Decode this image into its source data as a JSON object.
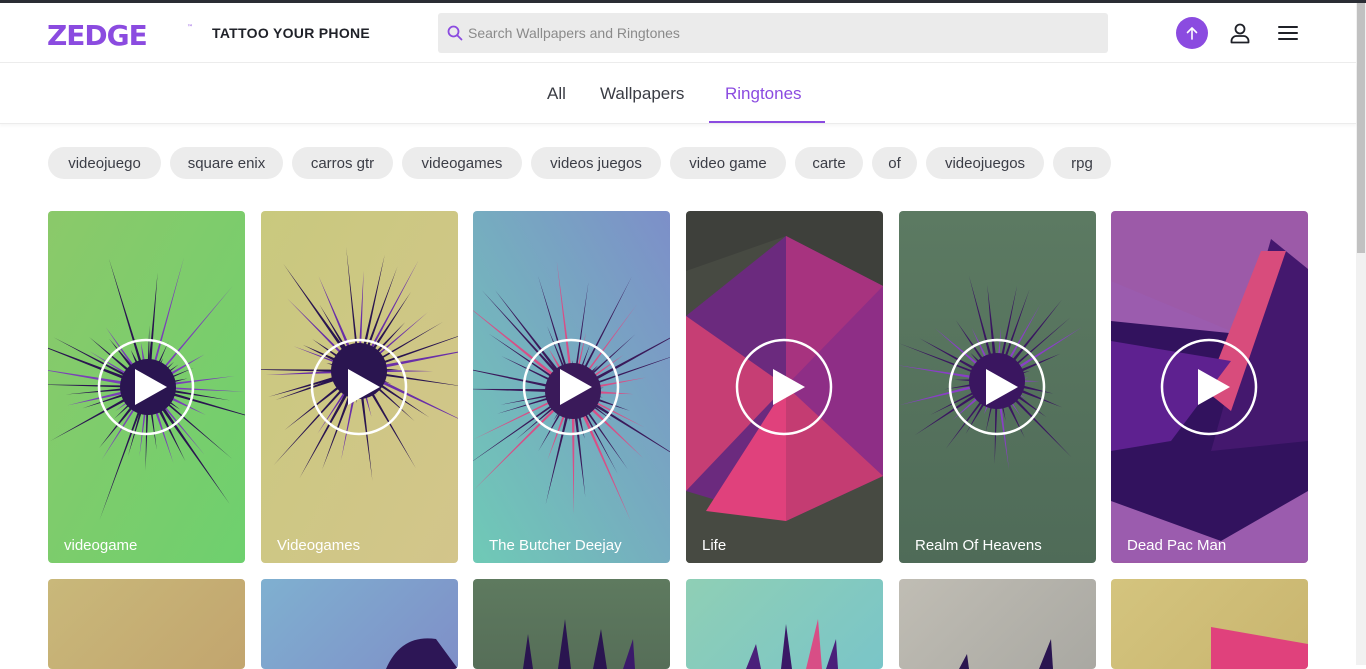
{
  "header": {
    "logo_text": "ZEDGE",
    "tagline": "TATTOO YOUR PHONE",
    "search_placeholder": "Search Wallpapers and Ringtones",
    "brand_color": "#8b4be0",
    "icons": [
      "search-icon",
      "upload-arrow-icon",
      "user-icon",
      "hamburger-menu-icon"
    ]
  },
  "tabs": [
    {
      "label": "All",
      "active": false
    },
    {
      "label": "Wallpapers",
      "active": false
    },
    {
      "label": "Ringtones",
      "active": true
    }
  ],
  "chips": [
    "videojuego",
    "square enix",
    "carros gtr",
    "videogames",
    "videos juegos",
    "video game",
    "carte",
    "of",
    "videojuegos",
    "rpg"
  ],
  "cards": [
    {
      "title": "videogame"
    },
    {
      "title": "Videogames"
    },
    {
      "title": "The Butcher Deejay"
    },
    {
      "title": "Life"
    },
    {
      "title": "Realm Of Heavens"
    },
    {
      "title": "Dead Pac Man"
    }
  ]
}
